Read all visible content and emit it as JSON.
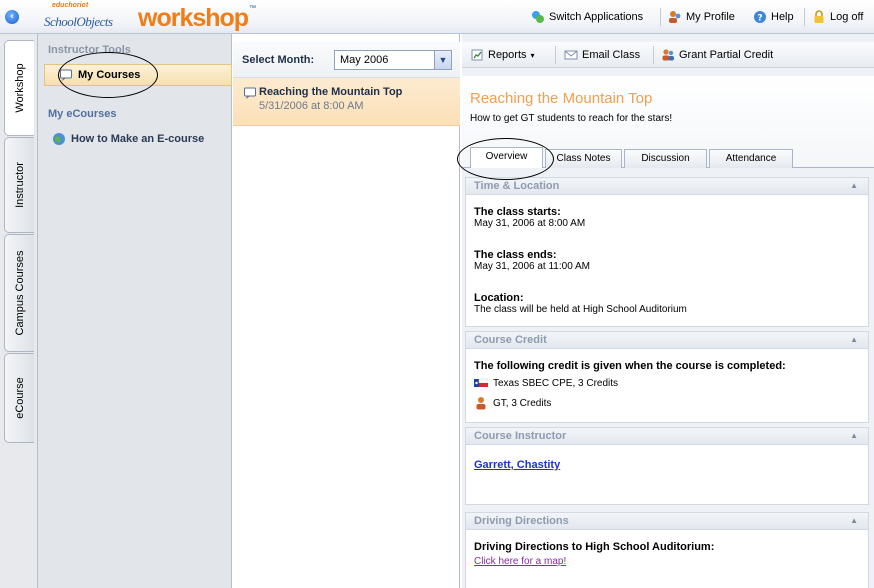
{
  "app": {
    "logo_small": "educhoriot",
    "logo_brand": "SchoolObjects",
    "logo_product": "workshop",
    "logo_tm": "™"
  },
  "topbar": {
    "switch_apps": "Switch Applications",
    "my_profile": "My Profile",
    "help": "Help",
    "log_off": "Log off"
  },
  "vtabs": [
    "Workshop",
    "Instructor",
    "Campus Courses",
    "eCourse"
  ],
  "nav": {
    "instructor_tools": "Instructor Tools",
    "my_courses": "My Courses",
    "my_ecourses": "My eCourses",
    "ecourse_item": "How to Make an E-course"
  },
  "list": {
    "select_month_label": "Select Month:",
    "month_value": "May 2006",
    "items": [
      {
        "title": "Reaching the Mountain Top",
        "date": "5/31/2006 at 8:00 AM"
      }
    ]
  },
  "detail": {
    "toolbar": {
      "reports": "Reports",
      "email_class": "Email Class",
      "grant_partial_credit": "Grant Partial Credit"
    },
    "title": "Reaching the Mountain Top",
    "description": "How to get GT students to reach for the stars!",
    "tabs": [
      "Overview",
      "Class Notes",
      "Discussion",
      "Attendance"
    ],
    "time_location": {
      "header": "Time & Location",
      "starts_label": "The class starts:",
      "starts_value": "May 31, 2006 at 8:00 AM",
      "ends_label": "The class ends:",
      "ends_value": "May 31, 2006 at 11:00 AM",
      "location_label": "Location:",
      "location_value": "The class will be held at High School Auditorium"
    },
    "course_credit": {
      "header": "Course Credit",
      "intro": "The following credit is given when the course is completed:",
      "credits": [
        "Texas SBEC CPE, 3 Credits",
        "GT, 3 Credits"
      ]
    },
    "course_instructor": {
      "header": "Course Instructor",
      "name": "Garrett, Chastity"
    },
    "driving_directions": {
      "header": "Driving Directions",
      "label": "Driving Directions to High School Auditorium:",
      "link": "Click here for a map!"
    }
  },
  "colors": {
    "accent_orange": "#f0a050",
    "brand_blue": "#1d4f96",
    "selection_bg": "#fbe0b8",
    "link_blue": "#1a33c9"
  }
}
